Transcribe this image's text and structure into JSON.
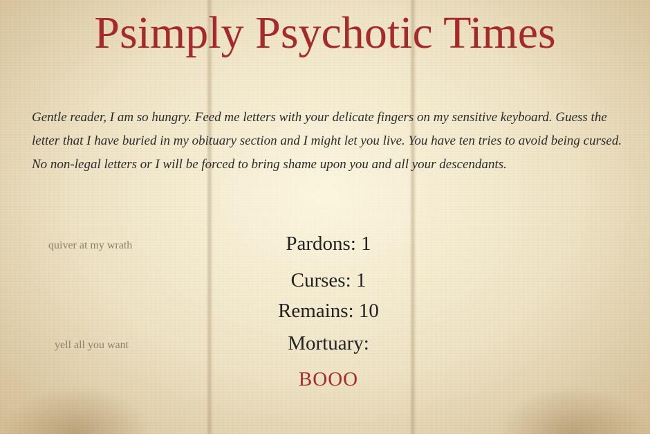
{
  "masthead": {
    "title": "Psimply Psychotic Times"
  },
  "intro": {
    "text": "Gentle reader, I am so hungry. Feed me letters with your delicate fingers on my sensitive keyboard. Guess the letter that I have buried in my obituary section and I might let you live. You have ten tries to avoid being cursed. No non-legal letters or I will be forced to bring shame upon you and all your descendants."
  },
  "side_notes": {
    "wrath": "quiver at my wrath",
    "yell": "yell all you want"
  },
  "stats": {
    "pardons": "Pardons: 1",
    "curses": "Curses: 1",
    "remains": "Remains: 10",
    "mortuary": "Mortuary:"
  },
  "word": {
    "display": "BOOO"
  },
  "colors": {
    "accent_red": "#a52a2a",
    "paper": "#ede2c6",
    "text": "#222222",
    "muted": "#8a8070"
  }
}
